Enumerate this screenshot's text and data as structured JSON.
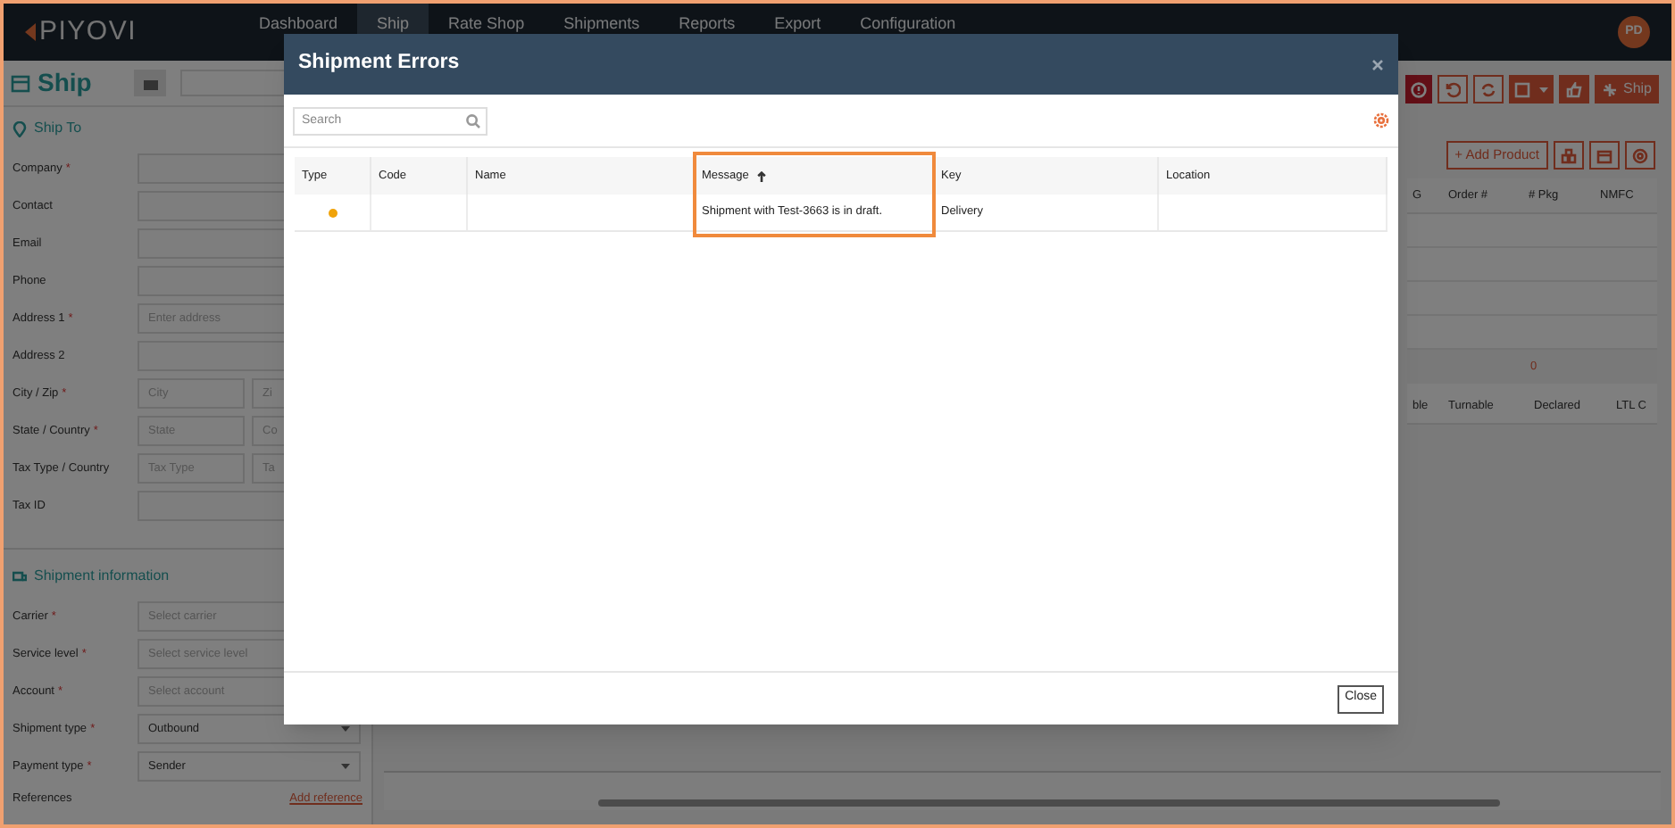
{
  "nav": {
    "logo": "PIYOVI",
    "avatar": "PD",
    "items": [
      {
        "label": "Dashboard",
        "selected": false
      },
      {
        "label": "Ship",
        "selected": true
      },
      {
        "label": "Rate Shop",
        "selected": false
      },
      {
        "label": "Shipments",
        "selected": false
      },
      {
        "label": "Reports",
        "selected": false
      },
      {
        "label": "Export",
        "selected": false
      },
      {
        "label": "Configuration",
        "selected": false
      }
    ]
  },
  "page": {
    "title": "Ship"
  },
  "ship_to": {
    "title": "Ship To",
    "fields": [
      {
        "label": "Company",
        "required_mark": "*",
        "inputs": [
          {
            "kind": "text"
          }
        ]
      },
      {
        "label": "Contact",
        "inputs": [
          {
            "kind": "text"
          }
        ]
      },
      {
        "label": "Email",
        "inputs": [
          {
            "kind": "text"
          }
        ]
      },
      {
        "label": "Phone",
        "inputs": [
          {
            "kind": "text"
          }
        ]
      },
      {
        "label": "Address 1",
        "required_mark": "*",
        "inputs": [
          {
            "placeholder": "Enter address"
          }
        ]
      },
      {
        "label": "Address 2",
        "inputs": [
          {
            "kind": "text"
          }
        ]
      },
      {
        "label": "City / Zip",
        "required_mark": "*",
        "inputs": [
          {
            "placeholder": "City"
          },
          {
            "placeholder": "Zi"
          }
        ]
      },
      {
        "label": "State / Country",
        "required_mark": "*",
        "inputs": [
          {
            "placeholder": "State"
          },
          {
            "placeholder": "Co"
          }
        ]
      },
      {
        "label": "Tax Type / Country",
        "inputs": [
          {
            "placeholder": "Tax Type"
          },
          {
            "placeholder": "Ta"
          }
        ]
      },
      {
        "label": "Tax ID",
        "inputs": [
          {
            "kind": "text"
          }
        ]
      }
    ]
  },
  "shipment_information": {
    "title": "Shipment information",
    "fields": [
      {
        "label": "Carrier",
        "required_mark": "*",
        "inputs": [
          {
            "placeholder": "Select carrier",
            "kind": "select"
          }
        ]
      },
      {
        "label": "Service level",
        "required_mark": "*",
        "inputs": [
          {
            "placeholder": "Select service level"
          }
        ]
      },
      {
        "label": "Account",
        "required_mark": "*",
        "inputs": [
          {
            "placeholder": "Select account"
          }
        ]
      },
      {
        "label": "Shipment type",
        "required_mark": "*",
        "inputs": [
          {
            "value": "Outbound",
            "kind": "select"
          }
        ]
      },
      {
        "label": "Payment type",
        "required_mark": "*",
        "inputs": [
          {
            "value": "Sender",
            "kind": "select"
          }
        ]
      }
    ],
    "references": {
      "label": "References",
      "link": "Add reference"
    }
  },
  "toolbar": {
    "ship_button": "Ship"
  },
  "products": {
    "add_button": "+ Add Product",
    "columns": [
      "G",
      "Order #",
      "# Pkg",
      "NMFC"
    ],
    "total": "0",
    "columns_2": [
      "ble",
      "Turnable",
      "Declared",
      "LTL C"
    ]
  },
  "dialog": {
    "title": "Shipment Errors",
    "search": {
      "placeholder": "Search"
    },
    "columns": [
      {
        "label": "Type",
        "kind": "type",
        "sorted": false,
        "highlighted": false
      },
      {
        "label": "Code",
        "kind": "code",
        "sorted": false,
        "highlighted": false
      },
      {
        "label": "Name",
        "kind": "name",
        "sorted": false,
        "highlighted": false
      },
      {
        "label": "Message",
        "kind": "message",
        "sorted": true,
        "highlighted": true
      },
      {
        "label": "Key",
        "kind": "key",
        "sorted": false,
        "highlighted": false
      },
      {
        "label": "Location",
        "kind": "location",
        "sorted": false,
        "highlighted": false
      }
    ],
    "rows": [
      {
        "color": "#f0a30a",
        "message": "Shipment with Test-3663 is in draft.",
        "key": "Delivery"
      }
    ],
    "close_button": "Close"
  }
}
